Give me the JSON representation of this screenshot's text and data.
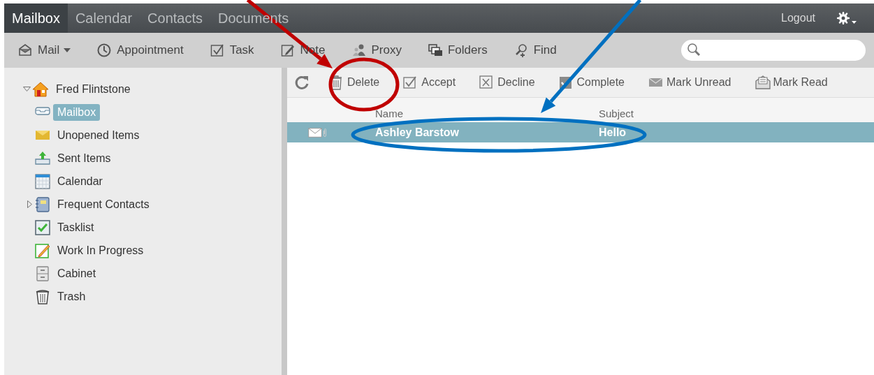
{
  "nav_tabs": [
    {
      "label": "Mailbox",
      "selected": true
    },
    {
      "label": "Calendar",
      "selected": false
    },
    {
      "label": "Contacts",
      "selected": false
    },
    {
      "label": "Documents",
      "selected": false
    }
  ],
  "logout": "Logout",
  "toolbar": [
    {
      "kind": "mail",
      "label": "Mail",
      "dropdown": true
    },
    {
      "kind": "appointment",
      "label": "Appointment"
    },
    {
      "kind": "task",
      "label": "Task"
    },
    {
      "kind": "note",
      "label": "Note"
    },
    {
      "kind": "proxy",
      "label": "Proxy"
    },
    {
      "kind": "folders",
      "label": "Folders"
    },
    {
      "kind": "find",
      "label": "Find"
    }
  ],
  "tree": {
    "label": "Fred Flintstone",
    "expanded": true,
    "children": [
      {
        "kind": "mailbox",
        "label": "Mailbox",
        "selected": true
      },
      {
        "kind": "unopened",
        "label": "Unopened Items",
        "selected": false
      },
      {
        "kind": "sent",
        "label": "Sent Items",
        "selected": false
      },
      {
        "kind": "calendar",
        "label": "Calendar",
        "selected": false
      },
      {
        "kind": "contacts",
        "label": "Frequent Contacts",
        "selected": false,
        "expanded": false
      },
      {
        "kind": "tasklist",
        "label": "Tasklist",
        "selected": false
      },
      {
        "kind": "progress",
        "label": "Work In Progress",
        "selected": false
      },
      {
        "kind": "cabinet",
        "label": "Cabinet",
        "selected": false
      },
      {
        "kind": "trash",
        "label": "Trash",
        "selected": false
      }
    ]
  },
  "actions": [
    {
      "kind": "delete",
      "label": "Delete"
    },
    {
      "kind": "accept",
      "label": "Accept"
    },
    {
      "kind": "decline",
      "label": "Decline"
    },
    {
      "kind": "complete",
      "label": "Complete"
    },
    {
      "kind": "unread",
      "label": "Mark Unread"
    },
    {
      "kind": "read",
      "label": "Mark Read"
    }
  ],
  "message_list": {
    "columns": [
      "Name",
      "Subject"
    ],
    "rows": [
      {
        "name": "Ashley Barstow",
        "subject": "Hello",
        "selected": true,
        "attachment": true
      }
    ]
  },
  "annotations": [
    {
      "kind": "arrow",
      "color": "#c00000"
    },
    {
      "kind": "ellipse",
      "color": "#c00000"
    },
    {
      "kind": "arrow",
      "color": "#0070c0"
    },
    {
      "kind": "ellipse",
      "color": "#0070c0"
    }
  ]
}
